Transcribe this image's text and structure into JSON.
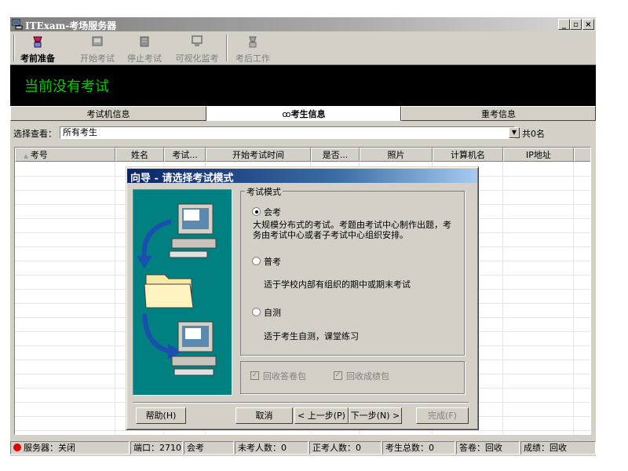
{
  "window": {
    "title": "ITExam-考场服务器"
  },
  "toolbar": {
    "items": [
      {
        "label": "考前准备",
        "icon": "preparation-icon",
        "enabled": true
      },
      {
        "label": "开始考试",
        "icon": "start-exam-icon",
        "enabled": false
      },
      {
        "label": "停止考试",
        "icon": "stop-exam-icon",
        "enabled": false
      },
      {
        "label": "可视化监考",
        "icon": "monitor-icon",
        "enabled": false
      },
      {
        "label": "考后工作",
        "icon": "post-exam-icon",
        "enabled": false
      }
    ]
  },
  "banner": {
    "text": "当前没有考试"
  },
  "tabs": [
    {
      "label": "考试机信息",
      "selected": false
    },
    {
      "label": "考生信息",
      "selected": true,
      "icon": "glasses-icon"
    },
    {
      "label": "重考信息",
      "selected": false
    }
  ],
  "filter": {
    "label": "选择查看：",
    "value": "所有考生",
    "count": "共0名"
  },
  "grid": {
    "columns": [
      "考号",
      "姓名",
      "考试...",
      "开始考试时间",
      "是否...",
      "照片",
      "计算机名",
      "IP地址"
    ]
  },
  "dialog": {
    "title": "向导 - 请选择考试模式",
    "group_title": "考试模式",
    "options": [
      {
        "label": "会考",
        "selected": true,
        "description": "大规模分布式的考试。考题由考试中心制作出题，考务由考试中心或者子考试中心组织安排。"
      },
      {
        "label": "普考",
        "selected": false,
        "description": "适于学校内部有组织的期中或期末考试"
      },
      {
        "label": "自测",
        "selected": false,
        "description": "适于考生自测，课堂练习"
      }
    ],
    "checkboxes": [
      {
        "label": "回收答卷包",
        "checked": true,
        "enabled": false
      },
      {
        "label": "回收成绩包",
        "checked": true,
        "enabled": false
      }
    ],
    "buttons": {
      "help": "帮助(H)",
      "cancel": "取消",
      "prev": "< 上一步(P)",
      "next": "下一步(N) >",
      "finish": "完成(F)"
    }
  },
  "statusbar": {
    "server": "服务器：关闭",
    "port": "端口：2710",
    "mode": "会考",
    "absent": "未考人数：0",
    "in_exam": "正考人数：0",
    "total": "考生总数：0",
    "answers": "答卷：回收",
    "scores": "成绩：回收"
  },
  "colors": {
    "banner_bg": "#000000",
    "banner_text": "#00cc00",
    "dialog_title": "#0a246a",
    "illustration_bg": "#008080",
    "server_led": "#e00000"
  }
}
